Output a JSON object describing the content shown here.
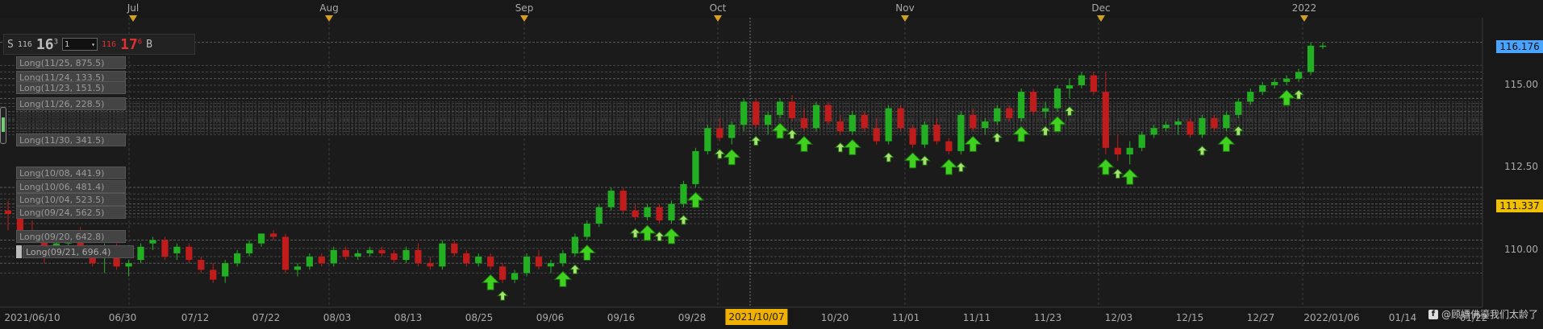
{
  "top_axis": {
    "labels": [
      "Jul",
      "Aug",
      "Sep",
      "Oct",
      "Nov",
      "Dec",
      "2022"
    ]
  },
  "bottom_axis": {
    "labels": [
      "2021/06/10",
      "06/30",
      "07/12",
      "07/22",
      "08/03",
      "08/13",
      "08/25",
      "09/06",
      "09/16",
      "09/28",
      "10/20",
      "11/01",
      "11/11",
      "11/23",
      "12/03",
      "12/15",
      "12/27",
      "2022/01/06",
      "01/14",
      "01/22"
    ],
    "highlight_date": "2021/10/07"
  },
  "price_axis": {
    "labels": [
      "115.00",
      "112.50",
      "110.00"
    ],
    "current_price_tag": "116.176",
    "current_price_color": "#4aa3ff",
    "alt_price_tag": "111.337",
    "alt_price_color": "#f0c000"
  },
  "quote": {
    "sell_label": "S",
    "sell_prefix": "116",
    "sell_big": "16",
    "sell_sup": "3",
    "qty": "1",
    "buy_prefix": "116",
    "buy_big": "17",
    "buy_sup": "6",
    "buy_label": "B",
    "buy_color": "#e03030"
  },
  "orders": [
    {
      "text": "Long(11/25, 875.5)"
    },
    {
      "text": "Long(11/24, 133.5)"
    },
    {
      "text": "Long(11/23, 151.5)"
    },
    {
      "text": "Long(11/26, 228.5)"
    },
    {
      "text": "Long(11/30, 341.5)"
    },
    {
      "text": "Long(10/08, 441.9)"
    },
    {
      "text": "Long(10/06, 481.4)"
    },
    {
      "text": "Long(10/04, 523.5)"
    },
    {
      "text": "Long(09/24, 562.5)"
    },
    {
      "text": "Long(09/20, 642.8)"
    },
    {
      "text": "Long(09/21, 696.4)"
    }
  ],
  "watermark": {
    "fb_icon": "f",
    "text": "@顾嫖佛鎏我们太龄了"
  },
  "colors": {
    "up": "#22b022",
    "down": "#c01c1c",
    "arrow": "#40d020"
  },
  "chart_data": {
    "type": "candlestick",
    "ylim": [
      108.8,
      117.0
    ],
    "candles": [
      {
        "o": 111.2,
        "h": 111.5,
        "l": 110.6,
        "c": 111.1
      },
      {
        "o": 111.1,
        "h": 111.2,
        "l": 110.4,
        "c": 110.6
      },
      {
        "o": 110.6,
        "h": 110.9,
        "l": 110.3,
        "c": 110.4
      },
      {
        "o": 110.4,
        "h": 110.6,
        "l": 109.6,
        "c": 109.8
      },
      {
        "o": 109.9,
        "h": 110.3,
        "l": 109.8,
        "c": 110.2
      },
      {
        "o": 110.2,
        "h": 110.5,
        "l": 110.1,
        "c": 110.4
      },
      {
        "o": 110.5,
        "h": 110.7,
        "l": 109.9,
        "c": 110.0
      },
      {
        "o": 110.0,
        "h": 110.1,
        "l": 109.5,
        "c": 109.6
      },
      {
        "o": 109.8,
        "h": 110.2,
        "l": 109.3,
        "c": 110.1
      },
      {
        "o": 110.1,
        "h": 110.2,
        "l": 109.4,
        "c": 109.5
      },
      {
        "o": 109.5,
        "h": 109.7,
        "l": 109.2,
        "c": 109.6
      },
      {
        "o": 109.7,
        "h": 110.2,
        "l": 109.6,
        "c": 110.1
      },
      {
        "o": 110.2,
        "h": 110.4,
        "l": 110.0,
        "c": 110.3
      },
      {
        "o": 110.3,
        "h": 110.4,
        "l": 109.7,
        "c": 109.8
      },
      {
        "o": 109.9,
        "h": 110.2,
        "l": 109.7,
        "c": 110.1
      },
      {
        "o": 110.1,
        "h": 110.2,
        "l": 109.6,
        "c": 109.7
      },
      {
        "o": 109.7,
        "h": 109.8,
        "l": 109.3,
        "c": 109.4
      },
      {
        "o": 109.4,
        "h": 109.6,
        "l": 109.0,
        "c": 109.1
      },
      {
        "o": 109.2,
        "h": 109.7,
        "l": 109.0,
        "c": 109.6
      },
      {
        "o": 109.6,
        "h": 110.0,
        "l": 109.5,
        "c": 109.9
      },
      {
        "o": 109.9,
        "h": 110.3,
        "l": 109.8,
        "c": 110.2
      },
      {
        "o": 110.2,
        "h": 110.5,
        "l": 110.1,
        "c": 110.5
      },
      {
        "o": 110.5,
        "h": 110.6,
        "l": 110.3,
        "c": 110.4
      },
      {
        "o": 110.4,
        "h": 110.5,
        "l": 109.3,
        "c": 109.4
      },
      {
        "o": 109.4,
        "h": 109.6,
        "l": 109.2,
        "c": 109.5
      },
      {
        "o": 109.5,
        "h": 109.9,
        "l": 109.4,
        "c": 109.8
      },
      {
        "o": 109.8,
        "h": 109.9,
        "l": 109.5,
        "c": 109.6
      },
      {
        "o": 109.6,
        "h": 110.1,
        "l": 109.5,
        "c": 110.0
      },
      {
        "o": 110.0,
        "h": 110.1,
        "l": 109.7,
        "c": 109.8
      },
      {
        "o": 109.8,
        "h": 110.0,
        "l": 109.7,
        "c": 109.9
      },
      {
        "o": 109.9,
        "h": 110.1,
        "l": 109.8,
        "c": 110.0
      },
      {
        "o": 110.0,
        "h": 110.1,
        "l": 109.8,
        "c": 109.9
      },
      {
        "o": 109.9,
        "h": 110.0,
        "l": 109.6,
        "c": 109.7
      },
      {
        "o": 109.7,
        "h": 110.1,
        "l": 109.6,
        "c": 110.0
      },
      {
        "o": 110.0,
        "h": 110.2,
        "l": 109.5,
        "c": 109.6
      },
      {
        "o": 109.6,
        "h": 109.8,
        "l": 109.4,
        "c": 109.5
      },
      {
        "o": 109.5,
        "h": 110.3,
        "l": 109.4,
        "c": 110.2
      },
      {
        "o": 110.2,
        "h": 110.3,
        "l": 109.8,
        "c": 109.9
      },
      {
        "o": 109.9,
        "h": 110.0,
        "l": 109.5,
        "c": 109.6
      },
      {
        "o": 109.6,
        "h": 109.9,
        "l": 109.5,
        "c": 109.8
      },
      {
        "o": 109.8,
        "h": 109.9,
        "l": 109.4,
        "c": 109.5
      },
      {
        "o": 109.5,
        "h": 109.6,
        "l": 109.0,
        "c": 109.1
      },
      {
        "o": 109.1,
        "h": 109.4,
        "l": 109.0,
        "c": 109.3
      },
      {
        "o": 109.3,
        "h": 109.9,
        "l": 109.2,
        "c": 109.8
      },
      {
        "o": 109.8,
        "h": 110.0,
        "l": 109.4,
        "c": 109.5
      },
      {
        "o": 109.5,
        "h": 109.7,
        "l": 109.3,
        "c": 109.6
      },
      {
        "o": 109.6,
        "h": 110.0,
        "l": 109.5,
        "c": 109.9
      },
      {
        "o": 109.9,
        "h": 110.5,
        "l": 109.8,
        "c": 110.4
      },
      {
        "o": 110.4,
        "h": 110.9,
        "l": 110.3,
        "c": 110.8
      },
      {
        "o": 110.8,
        "h": 111.4,
        "l": 110.7,
        "c": 111.3
      },
      {
        "o": 111.3,
        "h": 111.9,
        "l": 111.2,
        "c": 111.8
      },
      {
        "o": 111.8,
        "h": 111.9,
        "l": 111.1,
        "c": 111.2
      },
      {
        "o": 111.2,
        "h": 111.4,
        "l": 110.9,
        "c": 111.0
      },
      {
        "o": 111.0,
        "h": 111.4,
        "l": 110.9,
        "c": 111.3
      },
      {
        "o": 111.3,
        "h": 111.4,
        "l": 110.8,
        "c": 110.9
      },
      {
        "o": 110.9,
        "h": 111.5,
        "l": 110.8,
        "c": 111.4
      },
      {
        "o": 111.4,
        "h": 112.1,
        "l": 111.3,
        "c": 112.0
      },
      {
        "o": 112.0,
        "h": 113.1,
        "l": 111.9,
        "c": 113.0
      },
      {
        "o": 113.0,
        "h": 113.8,
        "l": 112.9,
        "c": 113.7
      },
      {
        "o": 113.7,
        "h": 114.0,
        "l": 113.3,
        "c": 113.4
      },
      {
        "o": 113.4,
        "h": 113.9,
        "l": 113.2,
        "c": 113.8
      },
      {
        "o": 113.8,
        "h": 114.6,
        "l": 113.6,
        "c": 114.5
      },
      {
        "o": 114.5,
        "h": 114.6,
        "l": 113.7,
        "c": 113.8
      },
      {
        "o": 113.8,
        "h": 114.2,
        "l": 113.5,
        "c": 114.1
      },
      {
        "o": 114.1,
        "h": 114.6,
        "l": 114.0,
        "c": 114.5
      },
      {
        "o": 114.5,
        "h": 114.7,
        "l": 113.9,
        "c": 114.0
      },
      {
        "o": 114.0,
        "h": 114.3,
        "l": 113.6,
        "c": 113.7
      },
      {
        "o": 113.7,
        "h": 114.5,
        "l": 113.6,
        "c": 114.4
      },
      {
        "o": 114.4,
        "h": 114.5,
        "l": 113.8,
        "c": 113.9
      },
      {
        "o": 113.9,
        "h": 114.1,
        "l": 113.5,
        "c": 113.6
      },
      {
        "o": 113.6,
        "h": 114.2,
        "l": 113.5,
        "c": 114.1
      },
      {
        "o": 114.1,
        "h": 114.2,
        "l": 113.6,
        "c": 113.7
      },
      {
        "o": 113.7,
        "h": 114.0,
        "l": 113.2,
        "c": 113.3
      },
      {
        "o": 113.3,
        "h": 114.4,
        "l": 113.2,
        "c": 114.3
      },
      {
        "o": 114.3,
        "h": 114.4,
        "l": 113.6,
        "c": 113.7
      },
      {
        "o": 113.7,
        "h": 113.8,
        "l": 113.1,
        "c": 113.2
      },
      {
        "o": 113.2,
        "h": 113.9,
        "l": 113.1,
        "c": 113.8
      },
      {
        "o": 113.8,
        "h": 114.0,
        "l": 113.2,
        "c": 113.3
      },
      {
        "o": 113.3,
        "h": 113.4,
        "l": 112.9,
        "c": 113.0
      },
      {
        "o": 113.0,
        "h": 114.2,
        "l": 112.9,
        "c": 114.1
      },
      {
        "o": 114.1,
        "h": 114.3,
        "l": 113.6,
        "c": 113.7
      },
      {
        "o": 113.7,
        "h": 114.0,
        "l": 113.5,
        "c": 113.9
      },
      {
        "o": 113.9,
        "h": 114.4,
        "l": 113.8,
        "c": 114.3
      },
      {
        "o": 114.3,
        "h": 114.4,
        "l": 113.9,
        "c": 114.0
      },
      {
        "o": 114.0,
        "h": 114.9,
        "l": 113.9,
        "c": 114.8
      },
      {
        "o": 114.8,
        "h": 114.9,
        "l": 114.1,
        "c": 114.2
      },
      {
        "o": 114.2,
        "h": 114.5,
        "l": 114.0,
        "c": 114.3
      },
      {
        "o": 114.3,
        "h": 115.0,
        "l": 114.2,
        "c": 114.9
      },
      {
        "o": 114.9,
        "h": 115.2,
        "l": 114.6,
        "c": 115.0
      },
      {
        "o": 115.0,
        "h": 115.4,
        "l": 114.9,
        "c": 115.3
      },
      {
        "o": 115.3,
        "h": 115.4,
        "l": 114.7,
        "c": 114.8
      },
      {
        "o": 114.8,
        "h": 115.4,
        "l": 112.9,
        "c": 113.1
      },
      {
        "o": 113.1,
        "h": 113.5,
        "l": 112.7,
        "c": 112.9
      },
      {
        "o": 112.9,
        "h": 113.3,
        "l": 112.6,
        "c": 113.1
      },
      {
        "o": 113.1,
        "h": 113.6,
        "l": 113.0,
        "c": 113.5
      },
      {
        "o": 113.5,
        "h": 113.8,
        "l": 113.4,
        "c": 113.7
      },
      {
        "o": 113.7,
        "h": 113.9,
        "l": 113.6,
        "c": 113.8
      },
      {
        "o": 113.8,
        "h": 114.0,
        "l": 113.5,
        "c": 113.9
      },
      {
        "o": 113.9,
        "h": 114.0,
        "l": 113.4,
        "c": 113.5
      },
      {
        "o": 113.5,
        "h": 114.1,
        "l": 113.4,
        "c": 114.0
      },
      {
        "o": 114.0,
        "h": 114.1,
        "l": 113.6,
        "c": 113.7
      },
      {
        "o": 113.7,
        "h": 114.2,
        "l": 113.6,
        "c": 114.1
      },
      {
        "o": 114.1,
        "h": 114.6,
        "l": 114.0,
        "c": 114.5
      },
      {
        "o": 114.5,
        "h": 114.9,
        "l": 114.4,
        "c": 114.8
      },
      {
        "o": 114.8,
        "h": 115.1,
        "l": 114.7,
        "c": 115.0
      },
      {
        "o": 115.0,
        "h": 115.2,
        "l": 114.9,
        "c": 115.1
      },
      {
        "o": 115.1,
        "h": 115.3,
        "l": 115.0,
        "c": 115.2
      },
      {
        "o": 115.2,
        "h": 115.5,
        "l": 115.1,
        "c": 115.4
      },
      {
        "o": 115.4,
        "h": 116.3,
        "l": 115.3,
        "c": 116.2
      },
      {
        "o": 116.2,
        "h": 116.3,
        "l": 116.1,
        "c": 116.2
      }
    ],
    "long_markers": [
      {
        "i": 40
      },
      {
        "i": 41
      },
      {
        "i": 46
      },
      {
        "i": 47
      },
      {
        "i": 48
      },
      {
        "i": 52
      },
      {
        "i": 53
      },
      {
        "i": 54
      },
      {
        "i": 55
      },
      {
        "i": 56
      },
      {
        "i": 57
      },
      {
        "i": 59
      },
      {
        "i": 60
      },
      {
        "i": 62
      },
      {
        "i": 64
      },
      {
        "i": 65
      },
      {
        "i": 66
      },
      {
        "i": 69
      },
      {
        "i": 70
      },
      {
        "i": 73
      },
      {
        "i": 75
      },
      {
        "i": 76
      },
      {
        "i": 78
      },
      {
        "i": 79
      },
      {
        "i": 80
      },
      {
        "i": 82
      },
      {
        "i": 84
      },
      {
        "i": 86
      },
      {
        "i": 87
      },
      {
        "i": 88
      },
      {
        "i": 91
      },
      {
        "i": 92
      },
      {
        "i": 93
      },
      {
        "i": 99
      },
      {
        "i": 101
      },
      {
        "i": 102
      },
      {
        "i": 106
      },
      {
        "i": 107
      }
    ]
  }
}
